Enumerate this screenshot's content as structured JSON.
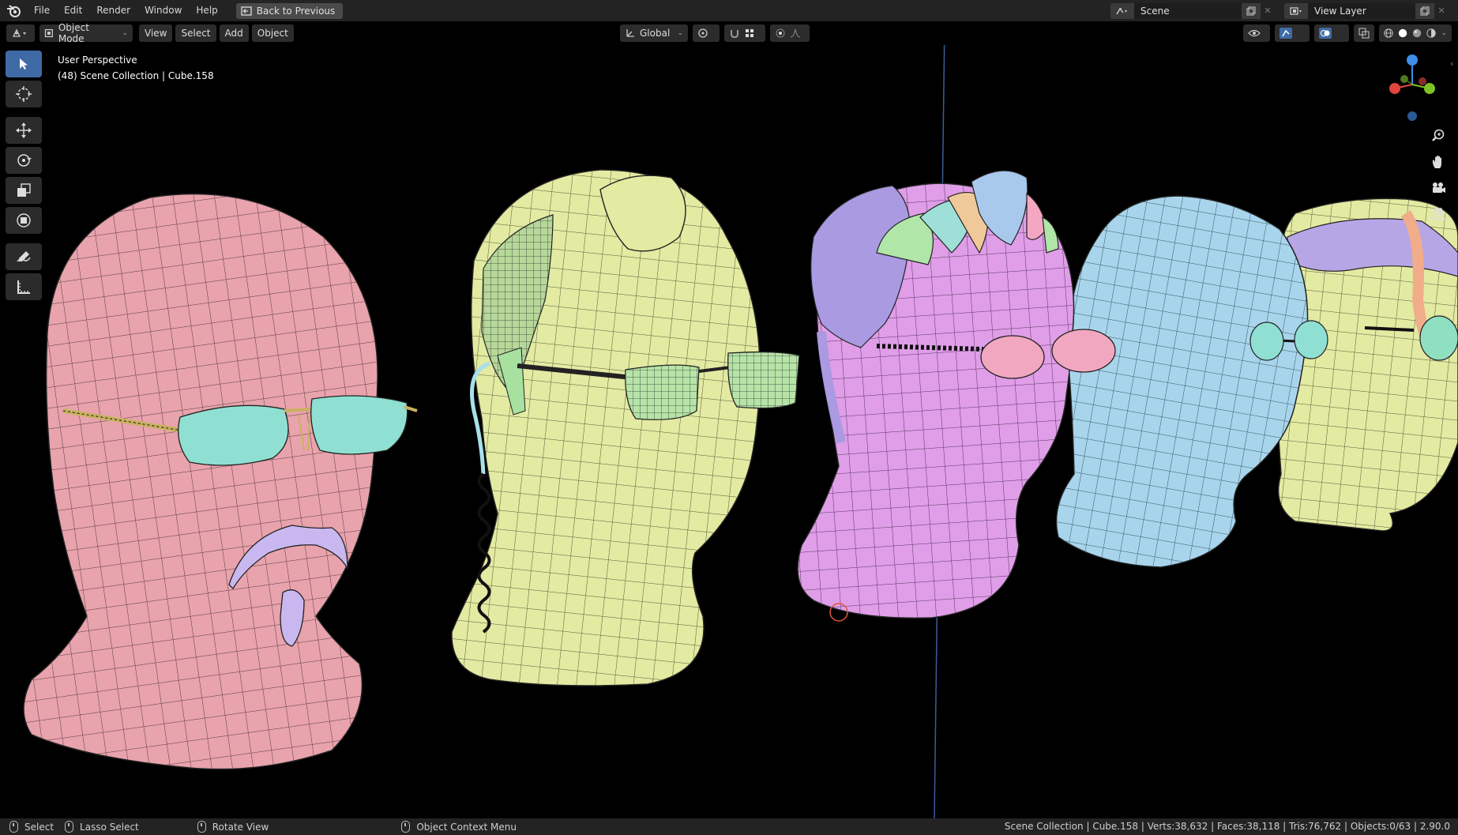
{
  "menu": {
    "items": [
      "File",
      "Edit",
      "Render",
      "Window",
      "Help"
    ],
    "back_button": "Back to Previous"
  },
  "top_right": {
    "scene": "Scene",
    "view_layer": "View Layer"
  },
  "header": {
    "mode": "Object Mode",
    "menus": [
      "View",
      "Select",
      "Add",
      "Object"
    ],
    "transform_orientation": "Global"
  },
  "viewport": {
    "perspective_label": "User Perspective",
    "collection_label": "(48) Scene Collection | Cube.158"
  },
  "gizmo": {
    "x_color": "#e2443f",
    "y_color": "#7ec226",
    "z_color": "#3d8fe8"
  },
  "colors": {
    "pink_head": "#e8a3ad",
    "yellow_head": "#e3eaa2",
    "magenta_head": "#df9ee7",
    "blue_head": "#a8d5ec",
    "lens_cyan": "#8fe0d2",
    "accent_blue": "#3f6aa5"
  },
  "statusbar": {
    "select": "Select",
    "lasso": "Lasso Select",
    "rotate": "Rotate View",
    "context": "Object Context Menu",
    "stats": "Scene Collection | Cube.158 | Verts:38,632 | Faces:38,118 | Tris:76,762 | Objects:0/63 | 2.90.0"
  }
}
